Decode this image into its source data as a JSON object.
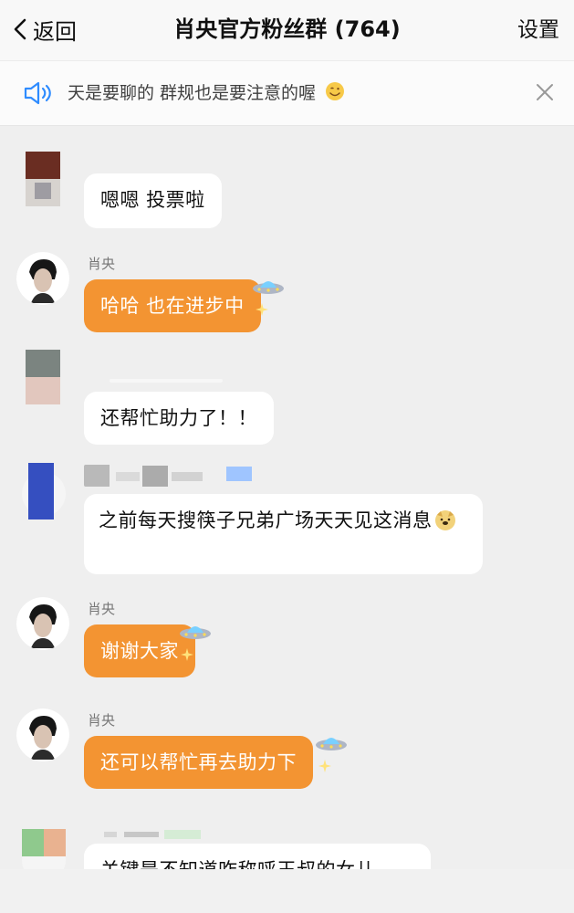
{
  "header": {
    "back_label": "返回",
    "title": "肖央官方粉丝群 (764)",
    "settings_label": "设置"
  },
  "notice": {
    "text": "天是要聊的 群规也是要注意的喔"
  },
  "messages": [
    {
      "sender": "",
      "text": "嗯嗯 投票啦",
      "style": "white"
    },
    {
      "sender": "肖央",
      "text": "哈哈 也在进步中",
      "style": "orange"
    },
    {
      "sender": "",
      "text": "还帮忙助力了！！",
      "style": "white"
    },
    {
      "sender": "",
      "text": "之前每天搜筷子兄弟广场天天见这消息",
      "style": "white"
    },
    {
      "sender": "肖央",
      "text": "谢谢大家",
      "style": "orange"
    },
    {
      "sender": "肖央",
      "text": "还可以帮忙再去助力下",
      "style": "orange"
    },
    {
      "sender": "",
      "text": "关键是不知道咋称呼王叔的女儿",
      "style": "white"
    }
  ],
  "icons": {
    "back": "chevron-left-icon",
    "speaker": "speaker-icon",
    "close": "close-icon",
    "ufo": "ufo-emoji",
    "sparkle": "sparkle-emoji",
    "dog": "doge-emoji",
    "wink": "wink-emoji"
  },
  "colors": {
    "header_bg": "#f8f8f8",
    "chat_bg": "#efefef",
    "orange_bubble": "#f39432",
    "white_bubble": "#ffffff",
    "accent_blue": "#2f8cff"
  }
}
